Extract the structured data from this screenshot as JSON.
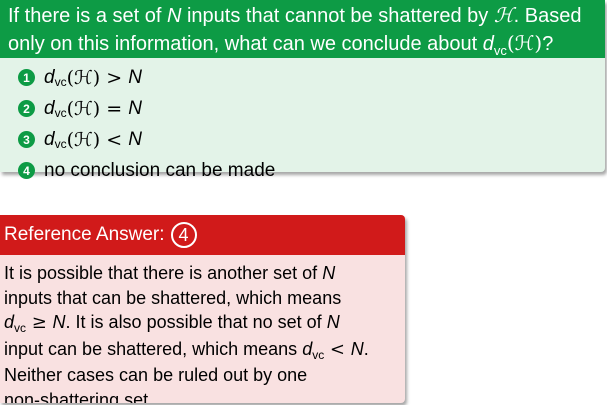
{
  "question": {
    "line1": {
      "pre": "If there is a set of ",
      "N": "N",
      "mid": " inputs that cannot be shattered by ",
      "H": "ℋ",
      "post": ". Based"
    },
    "line2": {
      "pre": "only on this information, what can we conclude about ",
      "d": "d",
      "sub": "vc",
      "paren": "(ℋ)",
      "post": "?"
    },
    "options": [
      {
        "num": "1",
        "d": "d",
        "sub": "vc",
        "paren": "(ℋ)",
        "op": " > ",
        "rhs": "N"
      },
      {
        "num": "2",
        "d": "d",
        "sub": "vc",
        "paren": "(ℋ)",
        "op": " = ",
        "rhs": "N"
      },
      {
        "num": "3",
        "d": "d",
        "sub": "vc",
        "paren": "(ℋ)",
        "op": " < ",
        "rhs": "N"
      },
      {
        "num": "4",
        "text": "no conclusion can be made"
      }
    ]
  },
  "answer": {
    "title": "Reference Answer:",
    "choice": "4",
    "line1": {
      "pre": "It is possible that there is another set of ",
      "N": "N"
    },
    "line2": {
      "text": "inputs that can be shattered, which means"
    },
    "line3": {
      "d": "d",
      "sub": "vc",
      "op": " ≥ ",
      "N": "N",
      "post": ". It is also possible that no set of ",
      "N2": "N"
    },
    "line4": {
      "pre": "input can be shattered, which means ",
      "d": "d",
      "sub": "vc",
      "op": " < ",
      "N": "N",
      "post": "."
    },
    "line5": {
      "text": "Neither cases can be ruled out by one"
    },
    "line6": {
      "text": "non-shattering set."
    }
  },
  "colors": {
    "green": "#0d9b45",
    "green_bg": "#e3f3e8",
    "red": "#d11a1a",
    "red_bg": "#f9e1e1"
  }
}
